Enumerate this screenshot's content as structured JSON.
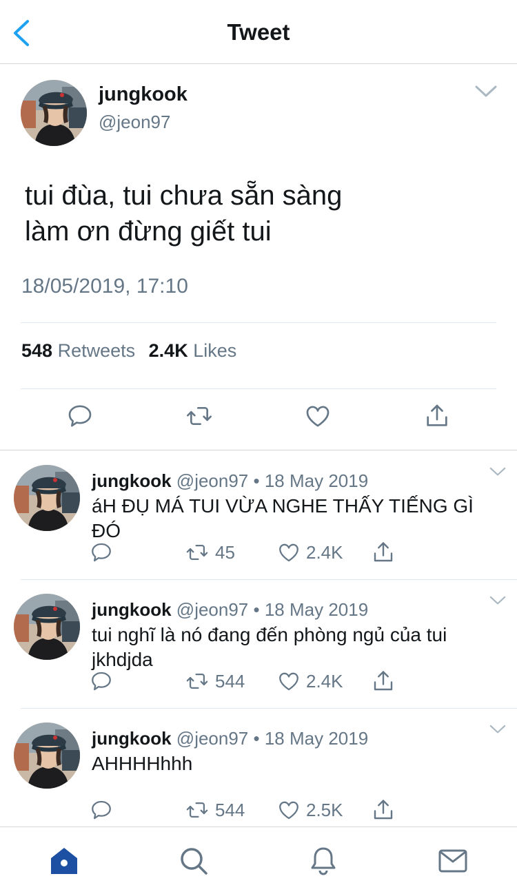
{
  "header": {
    "title": "Tweet"
  },
  "tweet": {
    "name": "jungkook",
    "handle": "@jeon97",
    "text": "tui đùa, tui chưa sẵn sàng\nlàm ơn đừng giết tui",
    "timestamp": "18/05/2019, 17:10",
    "retweets_count": "548",
    "retweets_label": "Retweets",
    "likes_count": "2.4K",
    "likes_label": "Likes"
  },
  "replies": [
    {
      "name": "jungkook",
      "handle": "@jeon97",
      "date": "18 May 2019",
      "text": "áH ĐỤ MÁ TUI VỪA NGHE THẤY TIẾNG GÌ ĐÓ",
      "retweets": "45",
      "likes": "2.4K"
    },
    {
      "name": "jungkook",
      "handle": "@jeon97",
      "date": "18 May 2019",
      "text": "tui nghĩ là nó đang đến phòng ngủ của tui jkhdjda",
      "retweets": "544",
      "likes": "2.4K"
    },
    {
      "name": "jungkook",
      "handle": "@jeon97",
      "date": "18 May 2019",
      "text": "AHHHHhhh",
      "retweets": "544",
      "likes": "2.5K"
    }
  ],
  "colors": {
    "accent": "#1da1f2",
    "muted": "#657786",
    "tab_active": "#1d4fa3"
  },
  "icons": [
    "back-chevron-icon",
    "chevron-down-icon",
    "reply-icon",
    "retweet-icon",
    "heart-icon",
    "share-icon",
    "home-icon",
    "search-icon",
    "bell-icon",
    "mail-icon"
  ]
}
